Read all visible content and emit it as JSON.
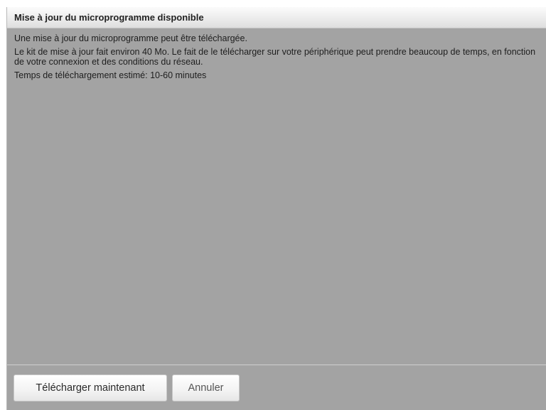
{
  "dialog": {
    "title": "Mise à jour du microprogramme disponible",
    "messages": [
      "Une mise à jour du microprogramme peut être téléchargée.",
      "Le kit de mise à jour fait environ 40 Mo. Le fait de le télécharger sur votre périphérique peut prendre beaucoup de temps, en fonction de votre connexion et des conditions du réseau.",
      "Temps de téléchargement estimé: 10-60 minutes"
    ],
    "buttons": {
      "download_now": "Télécharger maintenant",
      "cancel": "Annuler"
    }
  }
}
